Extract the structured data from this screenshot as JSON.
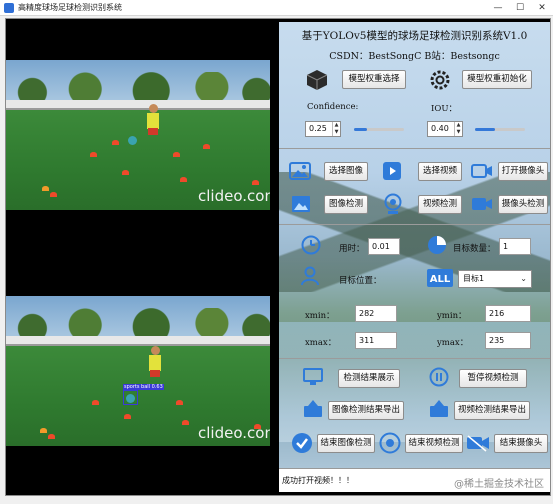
{
  "window": {
    "title": "高精度球场足球检测识别系统",
    "minimize": "—",
    "maximize": "☐",
    "close": "✕"
  },
  "video_top": {
    "watermark": "clideo.com"
  },
  "video_bottom": {
    "watermark": "clideo.com",
    "detection_label": "sports ball 0.63"
  },
  "header": {
    "title": "基于YOLOv5模型的球场足球检测识别系统V1.0",
    "credits": "CSDN：BestSongC   B站：Bestsongc"
  },
  "model": {
    "select_weights": "模型权重选择",
    "init_weights": "模型权重初始化",
    "confidence_label": "Confidence:",
    "confidence_value": "0.25",
    "confidence_level": 0.25,
    "iou_label": "IOU：",
    "iou_value": "0.40",
    "iou_level": 0.4
  },
  "inputs": {
    "select_image": "选择图像",
    "select_video": "选择视频",
    "open_camera": "打开摄像头",
    "image_detect": "图像检测",
    "video_detect": "视频检测",
    "camera_detect": "摄像头检测"
  },
  "results": {
    "time_label": "用时：",
    "time_value": "0.01",
    "count_label": "目标数量：",
    "count_value": "1",
    "position_label": "目标位置：",
    "target_select": "目标1",
    "xmin_label": "xmin：",
    "xmin_value": "282",
    "ymin_label": "ymin：",
    "ymin_value": "216",
    "xmax_label": "xmax：",
    "xmax_value": "311",
    "ymax_label": "ymax：",
    "ymax_value": "235"
  },
  "actions": {
    "show_results": "检测结果展示",
    "pause_video": "暂停视频检测",
    "export_image": "图像检测结果导出",
    "export_video": "视频检测结果导出",
    "end_image": "结束图像检测",
    "end_video": "结束视频检测",
    "end_camera": "结束摄像头"
  },
  "status": {
    "message": "成功打开视频！！！"
  },
  "footer": {
    "watermark": "@稀土掘金技术社区"
  },
  "colors": {
    "accent": "#2f7bd9",
    "detection_box": "#3a3ad8"
  }
}
